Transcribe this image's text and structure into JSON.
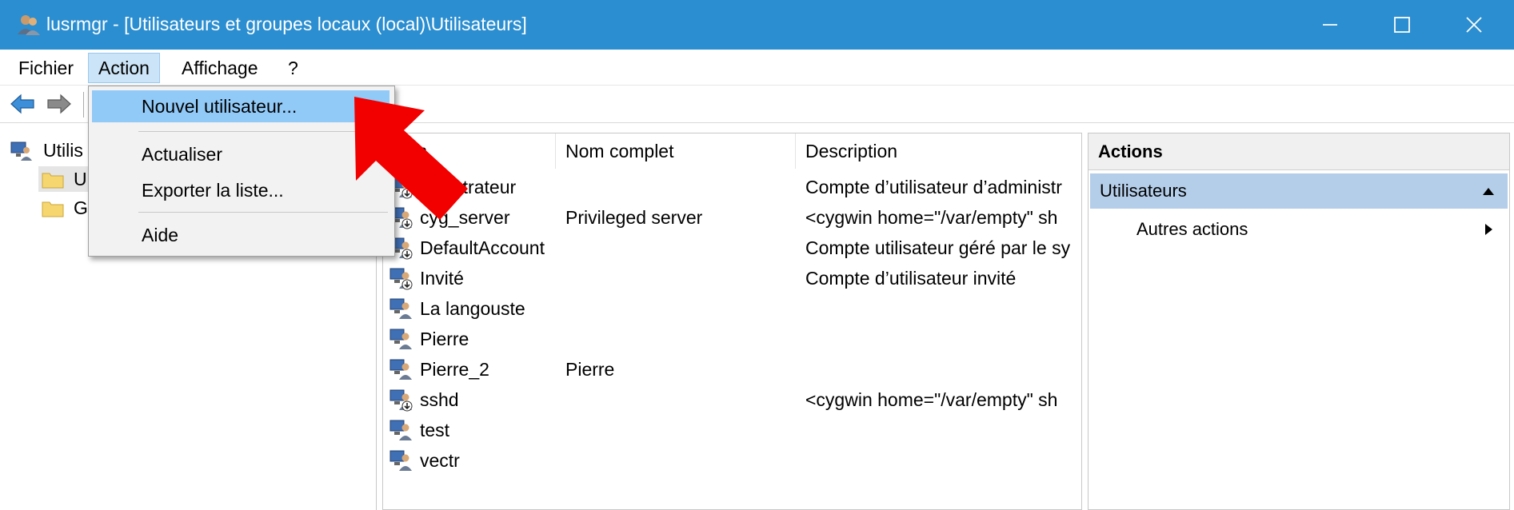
{
  "window": {
    "title": "lusrmgr - [Utilisateurs et groupes locaux (local)\\Utilisateurs]",
    "controls": [
      "minimize",
      "maximize",
      "close"
    ]
  },
  "menubar": {
    "items": [
      {
        "label": "Fichier"
      },
      {
        "label": "Action",
        "active": true
      },
      {
        "label": "Affichage"
      },
      {
        "label": "?"
      }
    ]
  },
  "toolbar": {
    "buttons": [
      "back-arrow-icon",
      "forward-arrow-icon"
    ]
  },
  "action_menu": {
    "items": [
      {
        "label": "Nouvel utilisateur...",
        "highlighted": true
      },
      {
        "label": "Actualiser"
      },
      {
        "label": "Exporter la liste..."
      },
      {
        "label": "Aide"
      }
    ]
  },
  "tree": {
    "root": "Utilis",
    "children": [
      "U",
      "G"
    ]
  },
  "list": {
    "columns": [
      "m",
      "Nom complet",
      "Description"
    ],
    "rows": [
      {
        "name": "Administrateur",
        "visible_name": "ministrateur",
        "full_name": "",
        "description": "Compte d’utilisateur d’administr",
        "disabled": true
      },
      {
        "name": "cyg_server",
        "full_name": "Privileged server",
        "description": "<cygwin home=\"/var/empty\" sh",
        "disabled": true
      },
      {
        "name": "DefaultAccount",
        "full_name": "",
        "description": "Compte utilisateur géré par le sy",
        "disabled": true
      },
      {
        "name": "Invité",
        "full_name": "",
        "description": "Compte d’utilisateur invité",
        "disabled": true
      },
      {
        "name": "La langouste",
        "full_name": "",
        "description": "",
        "disabled": false
      },
      {
        "name": "Pierre",
        "full_name": "",
        "description": "",
        "disabled": false
      },
      {
        "name": "Pierre_2",
        "full_name": "Pierre",
        "description": "",
        "disabled": false
      },
      {
        "name": "sshd",
        "full_name": "",
        "description": "<cygwin home=\"/var/empty\" sh",
        "disabled": true
      },
      {
        "name": "test",
        "full_name": "",
        "description": "",
        "disabled": false
      },
      {
        "name": "vectr",
        "full_name": "",
        "description": "",
        "disabled": false
      }
    ]
  },
  "actions_panel": {
    "header": "Actions",
    "section": "Utilisateurs",
    "item": "Autres actions"
  },
  "colors": {
    "titlebar": "#2b8ed0",
    "menu_highlight": "#91c9f7",
    "actions_section": "#b4cde8",
    "annotation_arrow": "#f20000"
  }
}
